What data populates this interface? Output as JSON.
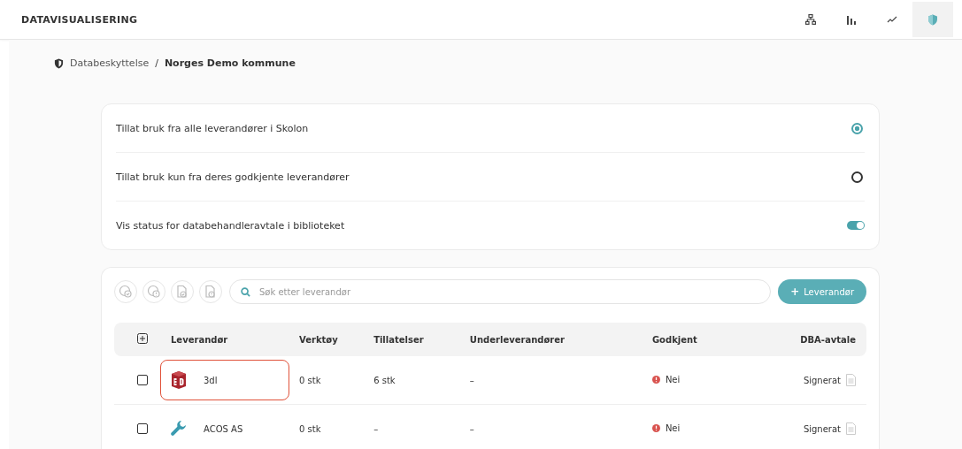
{
  "app_title": "DATAVISUALISERING",
  "nav_icons": [
    {
      "kind": "hierarchy",
      "selected": false
    },
    {
      "kind": "bars",
      "selected": false
    },
    {
      "kind": "trend",
      "selected": false
    },
    {
      "kind": "shield",
      "selected": true
    }
  ],
  "breadcrumb": {
    "parent": "Databeskyttelse",
    "separator": "/",
    "current": "Norges Demo kommune"
  },
  "settings": [
    {
      "kind": "radio",
      "label": "Tillat bruk fra alle leverandører i Skolon",
      "selected": true
    },
    {
      "kind": "radio",
      "label": "Tillat bruk kun fra deres godkjente leverandører",
      "selected": false
    },
    {
      "kind": "toggle",
      "label": "Vis status for databehandleravtale i biblioteket",
      "on": true
    }
  ],
  "toolbar": {
    "search_placeholder": "Søk etter leverandør",
    "add_button": "Leverandør",
    "add_symbol": "+"
  },
  "table": {
    "columns": [
      "Leverandør",
      "Verktøy",
      "Tillatelser",
      "Underleverandører",
      "Godkjent",
      "DBA-avtale"
    ],
    "rows": [
      {
        "checked": false,
        "kind": "cube",
        "highlighted": true,
        "name": "3dl",
        "tools": "0 stk",
        "permissions": "6 stk",
        "subcontractors": "–",
        "approved": "Nei",
        "dba": "Signerat"
      },
      {
        "checked": false,
        "kind": "wrench",
        "highlighted": false,
        "name": "ACOS AS",
        "tools": "0 stk",
        "permissions": "–",
        "subcontractors": "–",
        "approved": "Nei",
        "dba": "Signerat"
      }
    ]
  }
}
